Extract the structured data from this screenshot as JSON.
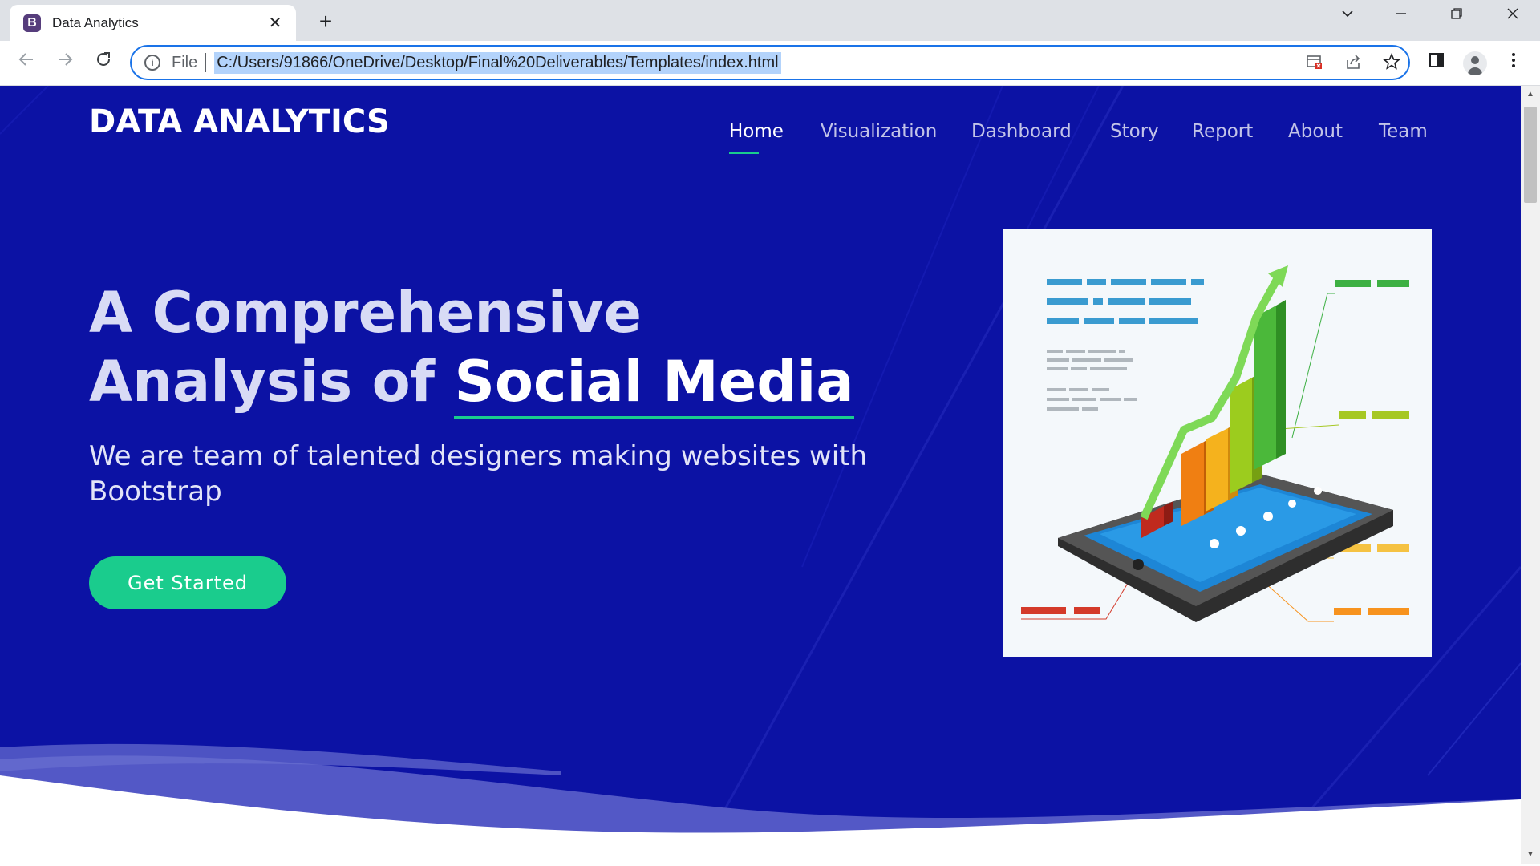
{
  "browser": {
    "tab_title": "Data Analytics",
    "favicon_letter": "B",
    "tab_close": "✕",
    "new_tab": "+",
    "scheme_label": "File",
    "url": "C:/Users/91866/OneDrive/Desktop/Final%20Deliverables/Templates/index.html",
    "icons": [
      "back-icon",
      "forward-icon",
      "reload-icon",
      "info-icon",
      "blocked-popup-icon",
      "share-icon",
      "bookmark-star-icon",
      "side-panel-icon",
      "profile-icon",
      "menu-icon"
    ]
  },
  "site": {
    "brand": "DATA ANALYTICS",
    "nav": [
      {
        "label": "Home",
        "active": true
      },
      {
        "label": "Visualization"
      },
      {
        "label": "Dashboard"
      },
      {
        "label": "Story"
      },
      {
        "label": "Report"
      },
      {
        "label": "About"
      },
      {
        "label": "Team"
      }
    ]
  },
  "hero": {
    "title_line1": "A Comprehensive",
    "title_line2_prefix": "Analysis of ",
    "title_highlight": "Social Media",
    "subtitle": "We are team of talented designers making websites with Bootstrap",
    "cta_label": "Get Started"
  },
  "colors": {
    "hero_bg": "#0c12a4",
    "accent": "#1acc8d",
    "favicon": "#563d7c"
  }
}
